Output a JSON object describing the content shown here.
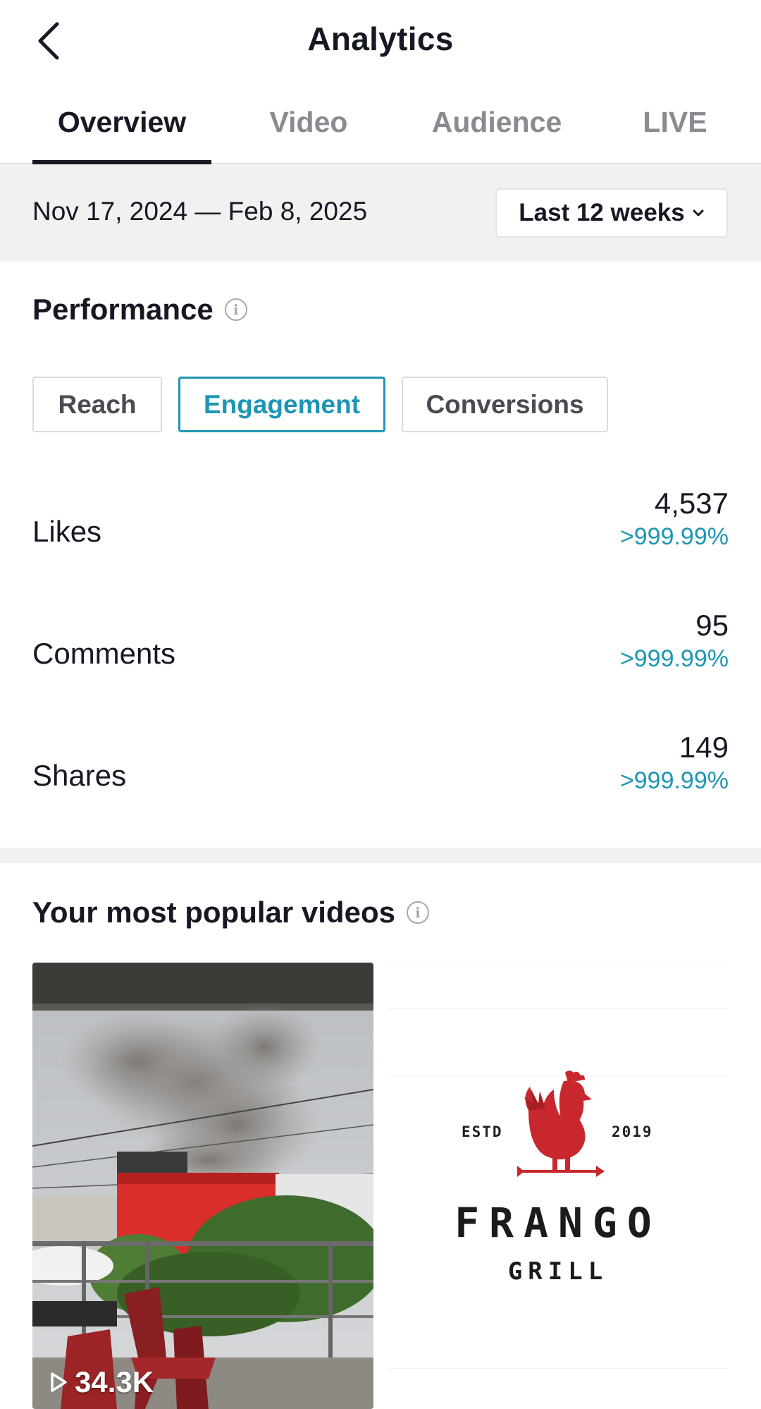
{
  "header": {
    "title": "Analytics"
  },
  "tabs": [
    {
      "label": "Overview",
      "active": true
    },
    {
      "label": "Video",
      "active": false
    },
    {
      "label": "Audience",
      "active": false
    },
    {
      "label": "LIVE",
      "active": false
    }
  ],
  "date_bar": {
    "range": "Nov 17, 2024 — Feb 8, 2025",
    "selected_period": "Last 12 weeks"
  },
  "performance": {
    "title": "Performance",
    "segments": [
      {
        "label": "Reach",
        "active": false
      },
      {
        "label": "Engagement",
        "active": true
      },
      {
        "label": "Conversions",
        "active": false
      }
    ],
    "metrics": [
      {
        "label": "Likes",
        "value": "4,537",
        "change": ">999.99%"
      },
      {
        "label": "Comments",
        "value": "95",
        "change": ">999.99%"
      },
      {
        "label": "Shares",
        "value": "149",
        "change": ">999.99%"
      }
    ]
  },
  "popular_videos": {
    "title": "Your most popular videos",
    "videos": [
      {
        "views": "34.3K",
        "description": "Smoke rising over a red restaurant building seen from a terrace with red chairs"
      },
      {
        "logo": {
          "estd": "ESTD",
          "year": "2019",
          "name": "FRANGO",
          "sub": "GRILL"
        }
      }
    ]
  },
  "colors": {
    "accent": "#1d96b4",
    "text": "#161823",
    "muted": "#8a8b91",
    "band": "#f1f1f2",
    "logo_red": "#c8282d"
  }
}
